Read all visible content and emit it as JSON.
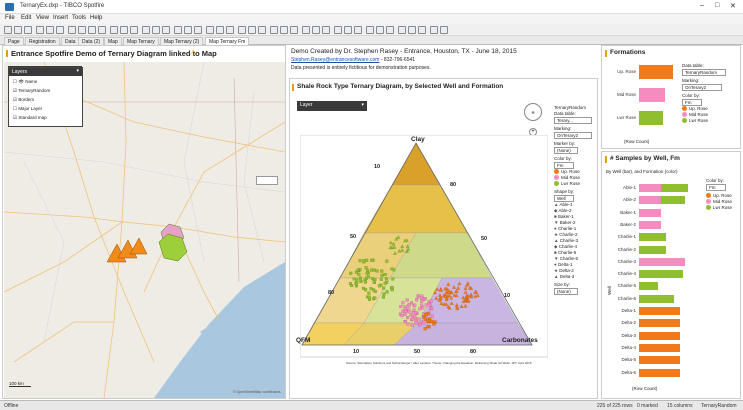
{
  "window": {
    "title": "TernaryEx.dxp - TIBCO Spotfire"
  },
  "menu": [
    "File",
    "Edit",
    "View",
    "Insert",
    "Tools",
    "Help"
  ],
  "tabs": [
    {
      "label": "Page",
      "active": false
    },
    {
      "label": "Registration",
      "active": false
    },
    {
      "label": "Data",
      "active": false
    },
    {
      "label": "Data (2)",
      "active": false
    },
    {
      "label": "Map",
      "active": false
    },
    {
      "label": "Map Ternary",
      "active": false
    },
    {
      "label": "Map Ternary (2)",
      "active": false
    },
    {
      "label": "Map Ternary Fm",
      "active": true
    }
  ],
  "map": {
    "title": "Entrance Spotfire Demo of Ternary Diagram linked to Map",
    "layers_title": "Layers",
    "layers": [
      {
        "label": "Name",
        "checked": false
      },
      {
        "label": "TernaryRandom",
        "checked": true
      },
      {
        "label": "Borders",
        "checked": true
      },
      {
        "label": "Major Layer",
        "checked": false
      },
      {
        "label": "Standard map",
        "checked": true
      }
    ],
    "scale": "100 km",
    "attribution": "© OpenStreetMap contributors"
  },
  "header": {
    "line1": "Demo Created by Dr. Stephen Rasey - Entrance, Houston, TX - June 18, 2015",
    "email": "Stephen.Rasey@entrancesoftware.com",
    "phone": "- 832-796-6541",
    "line3": "Data presented is entirely fictitious for demonstration purposes."
  },
  "ternary": {
    "title": "Shale Rock Type Ternary Diagram, by Selected Well and Formation",
    "layer_select": "Layer",
    "apex_top": "Clay",
    "apex_left": "QFM",
    "apex_right": "Carbonates",
    "ticks_left": [
      "10",
      "50",
      "80"
    ],
    "ticks_right": [
      "80",
      "50",
      "10"
    ],
    "ticks_bottom": [
      "80",
      "50",
      "10"
    ],
    "source": "Source: Stimulation Solutions and Schlumberger / after Lazarus, Thesis; Changing the Equation: Reframing Shale Oil Wells, JPT, April 2015",
    "controls": {
      "table_label": "TernaryRandom",
      "data_table_label": "Data table:",
      "data_table_value": "Terary...",
      "marking_label": "Marking:",
      "marking_value": "OnTerary2",
      "marker_label": "Marker by:",
      "marker_value": "(None)",
      "color_label": "Color by:",
      "color_value": "Fm",
      "color_items": [
        {
          "name": "Up. Rose",
          "color": "#f07a1a"
        },
        {
          "name": "Mid Rose",
          "color": "#f48cbf"
        },
        {
          "name": "Lwr Rose",
          "color": "#8fbf2f"
        }
      ],
      "shape_label": "Shape by:",
      "shape_value": "Well",
      "wells": [
        "Able-1",
        "Able-2",
        "Baker-1",
        "Baker-2",
        "Charlie-1",
        "Charlie-2",
        "Charlie-3",
        "Charlie-4",
        "Charlie-5",
        "Charlie-6",
        "Delta-1",
        "Delta-2",
        "Delta-3"
      ],
      "size_label": "Size by:",
      "size_value": "(None)"
    }
  },
  "formations": {
    "title": "Formations",
    "categories": [
      "Up. Rose",
      "Mid Rose",
      "Lwr Rose"
    ],
    "values": [
      42,
      33,
      30
    ],
    "colors": [
      "#f07a1a",
      "#f48cbf",
      "#8fbf2f"
    ],
    "axis_label": "(Row Count)",
    "data_table_label": "Data table:",
    "data_table_value": "TernaryRandom",
    "marking_label": "Marking:",
    "marking_value": "OnTerary2",
    "color_label": "Color by:",
    "color_value": "Fm"
  },
  "chart_data": {
    "type": "bar",
    "title": "# Samples by Well, Fm",
    "subtitle": "By Well (bar), and Formation (color)",
    "xlabel": "(Row Count)",
    "ylabel": "Well",
    "categories": [
      "Able-1",
      "Able-2",
      "Baker-1",
      "Baker-2",
      "Charlie-1",
      "Charlie-2",
      "Charlie-3",
      "Charlie-4",
      "Charlie-5",
      "Charlie-6",
      "Delta-1",
      "Delta-2",
      "Delta-3",
      "Delta-4",
      "Delta-5",
      "Delta-6"
    ],
    "series": [
      {
        "name": "Up. Rose",
        "color": "#f07a1a",
        "values": [
          0,
          0,
          0,
          0,
          0,
          0,
          0,
          0,
          0,
          0,
          15,
          15,
          15,
          15,
          15,
          15
        ]
      },
      {
        "name": "Mid Rose",
        "color": "#f48cbf",
        "values": [
          8,
          8,
          8,
          8,
          0,
          0,
          17,
          0,
          0,
          0,
          0,
          0,
          0,
          0,
          0,
          0
        ]
      },
      {
        "name": "Lwr Rose",
        "color": "#8fbf2f",
        "values": [
          10,
          9,
          0,
          0,
          10,
          10,
          0,
          16,
          7,
          13,
          0,
          0,
          0,
          0,
          0,
          0
        ]
      }
    ],
    "legend_title": "Color by:",
    "legend_value": "Fm"
  },
  "status": {
    "left": "Offline",
    "rows": "225 of 225 rows",
    "marked": "0 marked",
    "columns": "15 columns",
    "table": "TernaryRandom"
  }
}
